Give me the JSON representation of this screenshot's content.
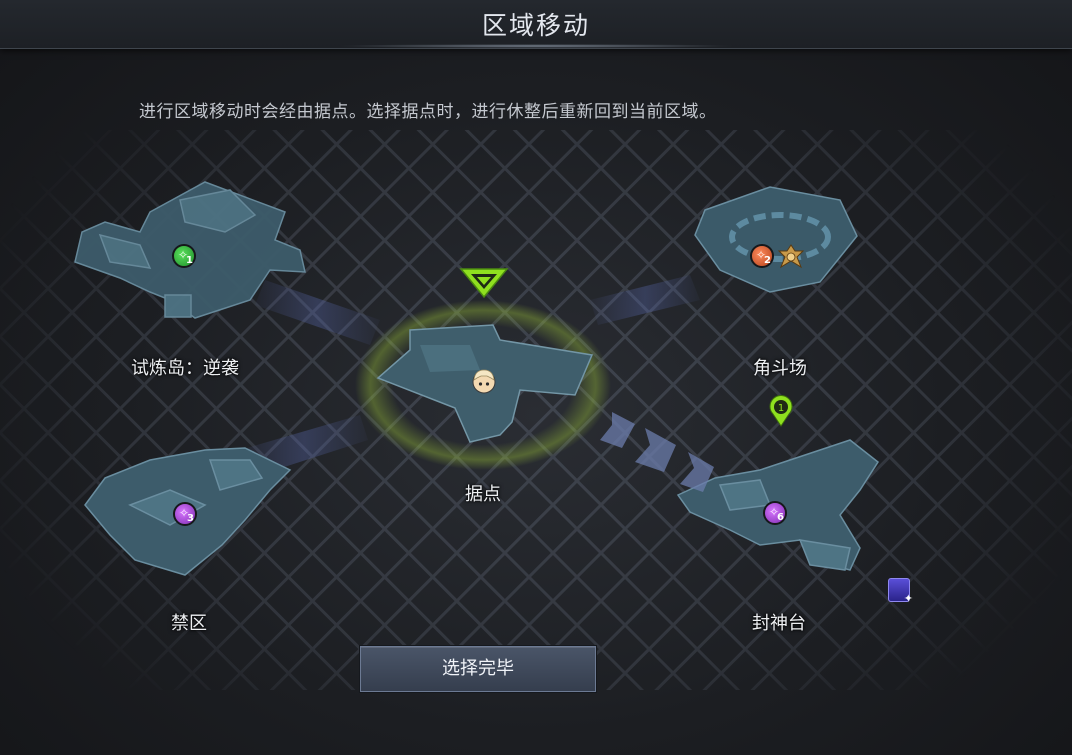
{
  "header": {
    "title": "区域移动"
  },
  "description": "进行区域移动时会经由据点。选择据点时，进行休整后重新回到当前区域。",
  "zones": [
    {
      "id": "trial",
      "label": "试炼岛：逆袭",
      "level": "1",
      "level_color": "#2fb43a"
    },
    {
      "id": "arena",
      "label": "角斗场",
      "level": "2",
      "level_color": "#d65a2c"
    },
    {
      "id": "base",
      "label": "据点",
      "current": true
    },
    {
      "id": "forbidden",
      "label": "禁区",
      "level": "3",
      "level_color": "#a246d6"
    },
    {
      "id": "altar",
      "label": "封神台",
      "level": "6",
      "level_color": "#a246d6",
      "pin_number": "1"
    }
  ],
  "confirm_button": {
    "label": "选择完毕"
  },
  "colors": {
    "map_fill": "#3f5f70",
    "map_stroke": "#6f93a4",
    "grid": "#454a55",
    "marker_green": "#8fe01f",
    "chevron": "#6e7fb0"
  },
  "icons": {
    "current": "green-chevron-marker-icon",
    "pin": "green-location-pin-icon",
    "avatar": "player-avatar-icon",
    "emblem": "arena-emblem-icon",
    "side": "character-card-icon"
  }
}
